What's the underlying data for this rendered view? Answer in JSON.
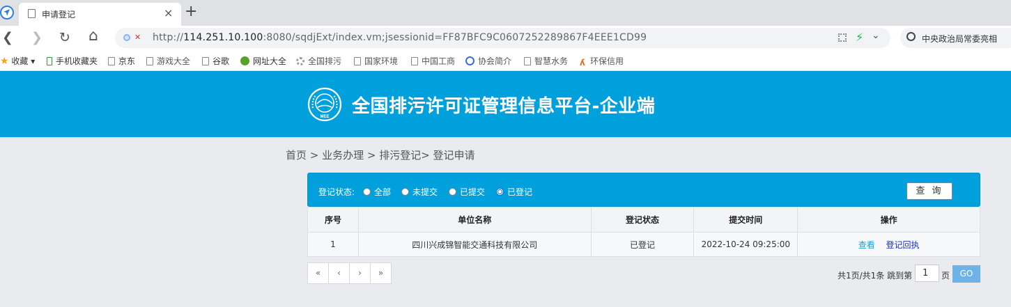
{
  "browser": {
    "tab_title": "申请登记",
    "tab_close": "×",
    "new_tab": "+",
    "url_prefix": "http://",
    "url_host": "114.251.10.100",
    "url_rest": ":8080/sqdjExt/index.vm;jsessionid=FF87BFC9C0607252289867F4EEE1CD99",
    "search_text": "中央政治局常委亮相",
    "nav": {
      "back": "❮",
      "forward": "❯",
      "reload": "↻",
      "home": "⌂"
    },
    "bookmarks": [
      {
        "label": "收藏",
        "icon": "star-icon"
      },
      {
        "label": "手机收藏夹",
        "icon": "phone-icon"
      },
      {
        "label": "京东",
        "icon": "page-icon"
      },
      {
        "label": "游戏大全",
        "icon": "page-icon"
      },
      {
        "label": "谷歌",
        "icon": "page-icon"
      },
      {
        "label": "网址大全",
        "icon": "plus-circle-icon"
      },
      {
        "label": "全国排污",
        "icon": "gear-icon"
      },
      {
        "label": "国家环境",
        "icon": "page-icon"
      },
      {
        "label": "中国工商",
        "icon": "page-icon"
      },
      {
        "label": "协会简介",
        "icon": "globe-icon"
      },
      {
        "label": "智慧水务",
        "icon": "page-icon"
      },
      {
        "label": "环保信用",
        "icon": "runner-icon"
      }
    ]
  },
  "header": {
    "title": "全国排污许可证管理信息平台-企业端",
    "logo_text": "MEE",
    "bg_color": "#00a0dc"
  },
  "breadcrumb": "首页 > 业务办理 > 排污登记> 登记申请",
  "filter": {
    "label": "登记状态:",
    "options": [
      {
        "label": "全部",
        "selected": false
      },
      {
        "label": "未提交",
        "selected": false
      },
      {
        "label": "已提交",
        "selected": false
      },
      {
        "label": "已登记",
        "selected": true
      }
    ],
    "query_button": "查 询"
  },
  "table": {
    "columns": [
      "序号",
      "单位名称",
      "登记状态",
      "提交时间",
      "操作"
    ],
    "rows": [
      {
        "index": "1",
        "company": "四川兴成锦智能交通科技有限公司",
        "status": "已登记",
        "submit_time": "2022-10-24 09:25:00",
        "actions": [
          "查看",
          "登记回执"
        ]
      }
    ]
  },
  "pagination": {
    "first": "«",
    "prev": "‹",
    "next": "›",
    "last": "»",
    "info": "共1页/共1条 跳到第",
    "page_value": "1",
    "unit": "页",
    "go": "GO"
  }
}
